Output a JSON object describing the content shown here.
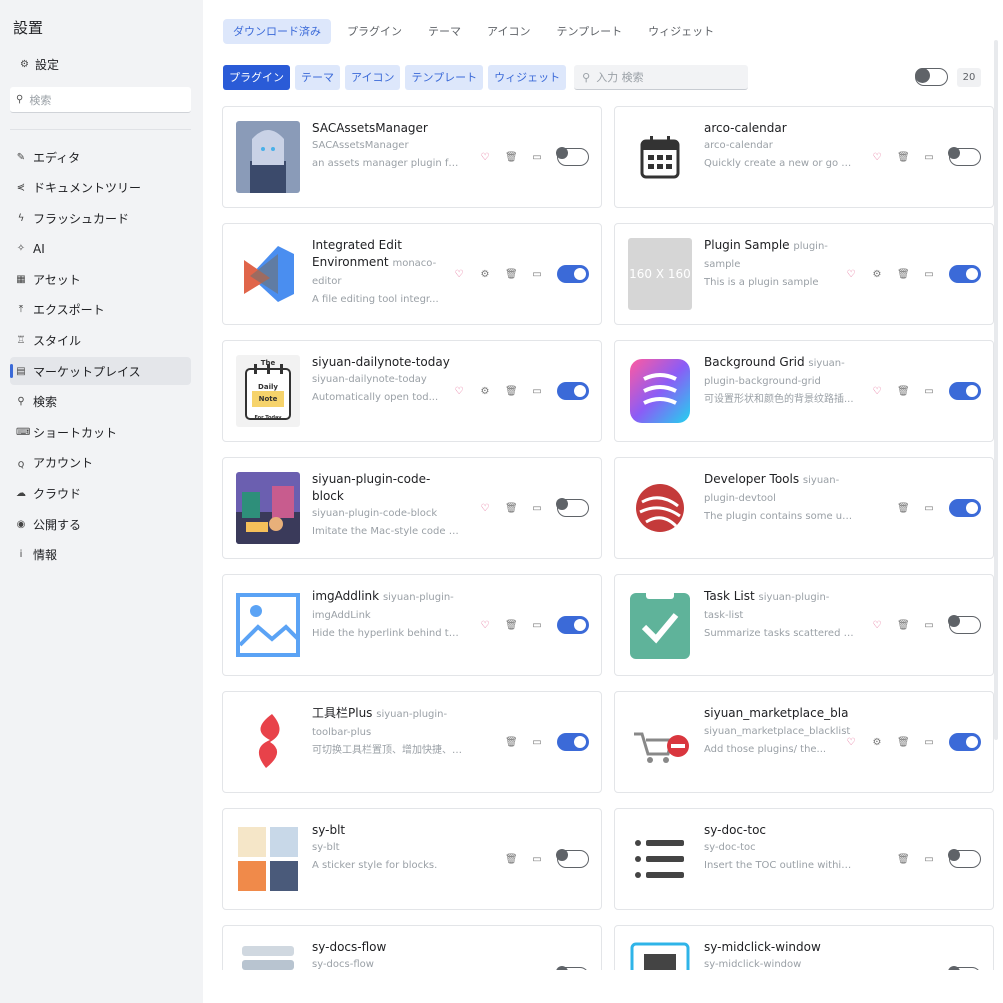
{
  "sidebar": {
    "title": "設置",
    "settings_label": "設定",
    "search_placeholder": "検索",
    "items": [
      {
        "label": "エディタ",
        "icon": "✎"
      },
      {
        "label": "ドキュメントツリー",
        "icon": "⋞"
      },
      {
        "label": "フラッシュカード",
        "icon": "ϟ"
      },
      {
        "label": "AI",
        "icon": "✧"
      },
      {
        "label": "アセット",
        "icon": "▦"
      },
      {
        "label": "エクスポート",
        "icon": "⤒"
      },
      {
        "label": "スタイル",
        "icon": "♖"
      },
      {
        "label": "マーケットプレイス",
        "icon": "▤"
      },
      {
        "label": "検索",
        "icon": "⚲"
      },
      {
        "label": "ショートカット",
        "icon": "⌨"
      },
      {
        "label": "アカウント",
        "icon": "ꞯ"
      },
      {
        "label": "クラウド",
        "icon": "☁"
      },
      {
        "label": "公開する",
        "icon": "◉"
      },
      {
        "label": "情報",
        "icon": "i"
      }
    ]
  },
  "top_tabs": [
    "ダウンロード済み",
    "プラグイン",
    "テーマ",
    "アイコン",
    "テンプレート",
    "ウィジェット"
  ],
  "filters": {
    "chips": [
      "プラグイン",
      "テーマ",
      "アイコン",
      "テンプレート",
      "ウィジェット"
    ],
    "search_placeholder": "入力 検索",
    "count": "20"
  },
  "cards": [
    {
      "name": "SACAssetsManager",
      "pkg": "SACAssetsManager",
      "desc": "an assets manager plugin for...",
      "enabled": false,
      "settings": false
    },
    {
      "name": "arco-calendar",
      "pkg": "arco-calendar",
      "desc": "Quickly create a new or go to...",
      "enabled": false,
      "settings": false
    },
    {
      "name": "Integrated Edit Environment",
      "pkg": "monaco-editor",
      "desc": "A file editing tool integr...",
      "enabled": true,
      "settings": true
    },
    {
      "name": "Plugin Sample",
      "pkg": "plugin-sample",
      "desc": "This is a plugin sample",
      "enabled": true,
      "settings": true,
      "placeholder": "160 X 160"
    },
    {
      "name": "siyuan-dailynote-today",
      "pkg": "siyuan-dailynote-today",
      "desc": "Automatically open tod...",
      "enabled": true,
      "settings": true,
      "icon_text": [
        "The",
        "Daily",
        "Note",
        "For Today"
      ]
    },
    {
      "name": "Background Grid",
      "pkg": "siyuan-plugin-background-grid",
      "desc": "可设置形状和颜色的背景纹路插...",
      "enabled": true,
      "settings": false
    },
    {
      "name": "siyuan-plugin-code-block",
      "pkg": "siyuan-plugin-code-block",
      "desc": "Imitate the Mac-style code bl...",
      "enabled": false,
      "settings": false
    },
    {
      "name": "Developer Tools",
      "pkg": "siyuan-plugin-devtool",
      "desc": "The plugin contains some useful q...",
      "enabled": true,
      "settings": false,
      "no_heart": true
    },
    {
      "name": "imgAddlink",
      "pkg": "siyuan-plugin-imgAddLink",
      "desc": "Hide the hyperlink behind th...",
      "enabled": true,
      "settings": false
    },
    {
      "name": "Task List",
      "pkg": "siyuan-plugin-task-list",
      "desc": "Summarize tasks scattered t...",
      "enabled": false,
      "settings": false
    },
    {
      "name": "工具栏Plus",
      "pkg": "siyuan-plugin-toolbar-plus",
      "desc": "可切换工具栏置顶、增加快捷、分栏等...",
      "enabled": true,
      "settings": false,
      "no_heart": true
    },
    {
      "name": "siyuan_marketplace_bla",
      "pkg": "siyuan_marketplace_blacklist",
      "desc": "Add those plugins/ the...",
      "enabled": true,
      "settings": true
    },
    {
      "name": "sy-blt",
      "pkg": "sy-blt",
      "desc": "A sticker style for blocks.",
      "enabled": false,
      "settings": false,
      "no_heart": true
    },
    {
      "name": "sy-doc-toc",
      "pkg": "sy-doc-toc",
      "desc": "Insert the TOC outline within the d...",
      "enabled": false,
      "settings": false,
      "no_heart": true
    },
    {
      "name": "sy-docs-flow",
      "pkg": "sy-docs-flow",
      "desc": "",
      "enabled": false,
      "settings": false
    },
    {
      "name": "sy-midclick-window",
      "pkg": "sy-midclick-window",
      "desc": "",
      "enabled": false,
      "settings": false
    }
  ]
}
